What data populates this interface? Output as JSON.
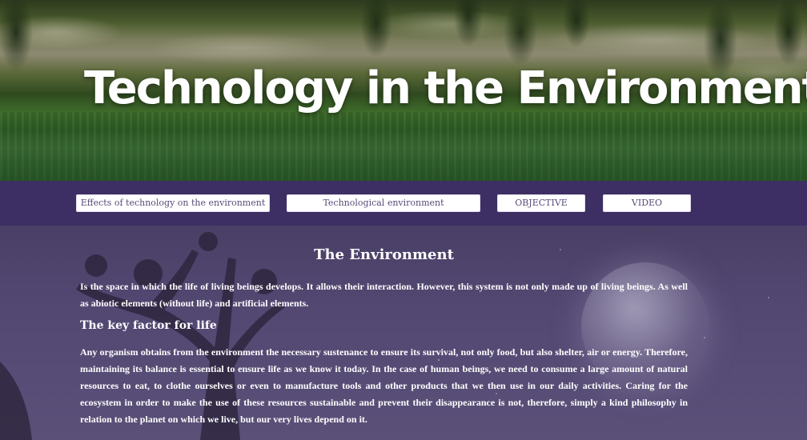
{
  "hero": {
    "title": "Technology in the Environment"
  },
  "nav": {
    "items": [
      {
        "label": "Effects of technology on the environment"
      },
      {
        "label": "Technological environment"
      },
      {
        "label": "OBJECTIVE"
      },
      {
        "label": "VIDEO"
      }
    ]
  },
  "main": {
    "section_title": "The Environment",
    "intro": "Is the space in which the life of living beings develops. It allows their interaction. However, this system is not only made up of living beings. As well as abiotic elements (without life) and artificial elements.",
    "subheading": "The key factor for life",
    "body": "Any organism obtains from the environment the necessary sustenance to ensure its survival, not only food, but also shelter, air or energy. Therefore, maintaining its balance is essential to ensure life as we know it today. In the case of human beings, we need to consume a large amount of natural resources to eat, to clothe ourselves or even to manufacture tools and other products that we then use in our daily activities. Caring for the ecosystem in order to make the use of these resources sustainable and prevent their disappearance is not, therefore, simply a kind philosophy in relation to the planet on which we live, but our very lives depend on it."
  },
  "colors": {
    "nav_background": "#3d2f63",
    "content_background": "#524872",
    "button_text": "#5a4a78"
  }
}
